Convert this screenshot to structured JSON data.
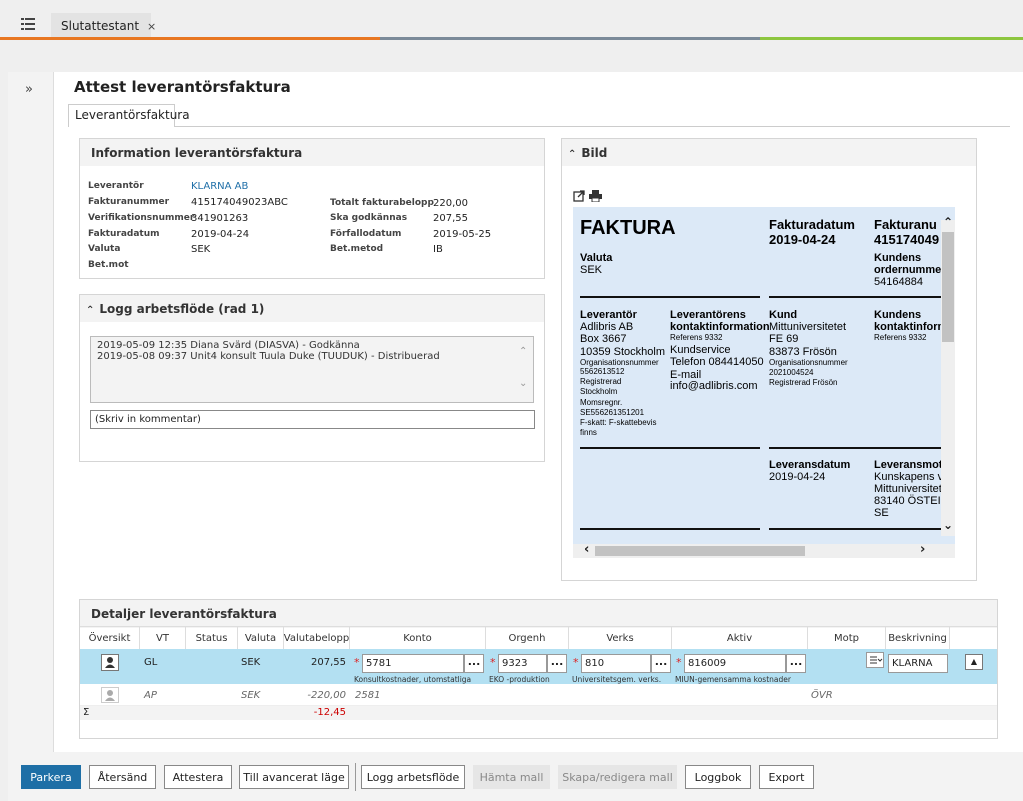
{
  "tab": {
    "title": "Slutattestant",
    "close": "×"
  },
  "stripe_colors": [
    "#e87722",
    "#7b8a99",
    "#8dc63f"
  ],
  "page_title": "Attest leverantörsfaktura",
  "subtab": "Leverantörsfaktura",
  "info": {
    "title": "Information leverantörsfaktura",
    "left": [
      {
        "label": "Leverantör",
        "value": "KLARNA AB"
      },
      {
        "label": "Fakturanummer",
        "value": "415174049023ABC"
      },
      {
        "label": "Verifikationsnummer",
        "value": "341901263"
      },
      {
        "label": "Fakturadatum",
        "value": "2019-04-24"
      },
      {
        "label": "Valuta",
        "value": "SEK"
      },
      {
        "label": "Bet.mot",
        "value": ""
      }
    ],
    "right": [
      {
        "label": "Totalt fakturabelopp",
        "value": "220,00"
      },
      {
        "label": "Ska godkännas",
        "value": "207,55"
      },
      {
        "label": "Förfallodatum",
        "value": "2019-05-25"
      },
      {
        "label": "Bet.metod",
        "value": "IB"
      }
    ]
  },
  "log": {
    "title": "Logg arbetsflöde (rad 1)",
    "entries": [
      "2019-05-09 12:35 Diana Svärd (DIASVA) - Godkänna",
      "2019-05-08 09:37 Unit4 konsult Tuula Duke (TUUDUK) - Distribuerad"
    ],
    "comment_placeholder": "(Skriv in kommentar)"
  },
  "image_panel": {
    "title": "Bild",
    "invoice": {
      "heading": "FAKTURA",
      "date_label": "Fakturadatum",
      "date": "2019-04-24",
      "nr_label": "Fakturanu",
      "nr": "415174049",
      "valuta_label": "Valuta",
      "valuta": "SEK",
      "kundens_order_label": "Kundens",
      "kundens_order_label2": "ordernummer",
      "kundens_order": "54164884",
      "lev_label": "Leverantör",
      "lev_lines": [
        "Adlibris AB",
        "Box 3667",
        "10359  Stockholm"
      ],
      "lev_small": [
        "Organisationsnummer",
        " 5562613512",
        "Registrerad",
        " Stockholm",
        "Momsregnr.",
        " SE556261351201",
        "F-skatt:  F-skattebevis",
        "finns"
      ],
      "levkontakt_label1": "Leverantörens",
      "levkontakt_label2": "kontaktinformation",
      "levkontakt_ref": "Referens  9332",
      "levkontakt_lines": [
        "Kundservice",
        "Telefon  084414050",
        "E-mail",
        " info@adlibris.com"
      ],
      "kund_label": "Kund",
      "kund_lines": [
        "Mittuniversitetet",
        "FE 69",
        "83873  Frösön"
      ],
      "kund_small": [
        "Organisationsnummer",
        " 2021004524",
        "Registrerad  Frösön"
      ],
      "kundkontakt_label1": "Kundens",
      "kundkontakt_label2": "kontaktinform",
      "kundkontakt_ref": "Referens  9332",
      "levdatum_label": "Leveransdatum",
      "levdatum": "2019-04-24",
      "levmot_label": "Leveransmot",
      "levmot_lines": [
        "Kunskapens v",
        "Mittuniversitet",
        "83140  ÖSTEI",
        "SE"
      ]
    }
  },
  "details": {
    "title": "Detaljer leverantörsfaktura",
    "columns": [
      "Översikt",
      "VT",
      "Status",
      "Valuta",
      "Valutabelopp",
      "Konto",
      "Orgenh",
      "Verks",
      "Aktiv",
      "Motp",
      "Beskrivning"
    ],
    "row1": {
      "vt": "GL",
      "valuta": "SEK",
      "belopp": "207,55",
      "konto": "5781",
      "konto_desc": "Konsultkostnader, utomstatliga",
      "orgenh": "9323",
      "orgenh_desc": "EKO -produktion",
      "verks": "810",
      "verks_desc": "Universitetsgem. verks.",
      "aktiv": "816009",
      "aktiv_desc": "MIUN-gemensamma kostnader",
      "beskrivning": "KLARNA"
    },
    "row2": {
      "vt": "AP",
      "valuta": "SEK",
      "belopp": "-220,00",
      "konto": "2581",
      "motp": "ÖVR"
    },
    "sum": {
      "symbol": "Σ",
      "belopp": "-12,45"
    },
    "dots": "..."
  },
  "buttons": [
    "Parkera",
    "Återsänd",
    "Attestera",
    "Till avancerat läge",
    "Logg arbetsflöde",
    "Hämta mall",
    "Skapa/redigera mall",
    "Loggbok",
    "Export"
  ],
  "colors": {
    "primary": "#1e6fa6",
    "selected_row": "#b3e0f2",
    "link": "#1f6fa8",
    "negative": "#cc0000"
  }
}
